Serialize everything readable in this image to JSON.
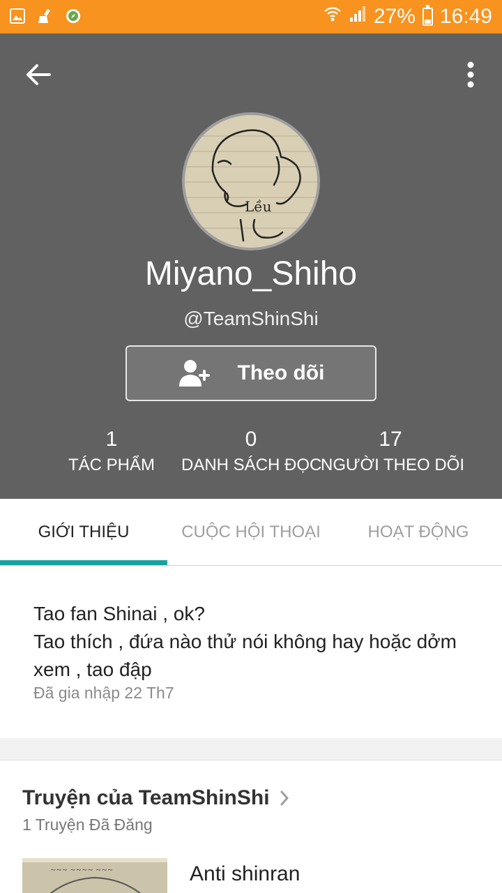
{
  "status_bar": {
    "battery_text": "27%",
    "battery_level": 0.27,
    "time": "16:49",
    "icons": [
      "gallery-icon",
      "cleaner-icon",
      "compass-icon",
      "wifi-icon",
      "signal-icon",
      "battery-icon"
    ]
  },
  "profile": {
    "username": "Miyano_Shiho",
    "handle": "@TeamShinShi",
    "follow_label": "Theo dõi",
    "stats": [
      {
        "value": "1",
        "label": "TÁC PHẨM"
      },
      {
        "value": "0",
        "label": "DANH SÁCH ĐỌC"
      },
      {
        "value": "17",
        "label": "NGƯỜI THEO DÕI"
      }
    ]
  },
  "tabs": [
    {
      "label": "GIỚI THIỆU",
      "active": true
    },
    {
      "label": "CUỘC HỘI THOẠI",
      "active": false
    },
    {
      "label": "HOẠT ĐỘNG",
      "active": false
    }
  ],
  "about": {
    "bio_lines": [
      "Tao fan Shinai , ok?",
      "Tao thích , đứa nào thử nói không hay hoặc dởm xem , tao đập"
    ],
    "joined": "Đã gia nhập 22 Th7"
  },
  "stories": {
    "title": "Truyện của TeamShinShi",
    "count_text": "1 Truyện Đã Đăng",
    "items": [
      {
        "title": "Anti shinran"
      }
    ]
  },
  "colors": {
    "status_bar": "#f7931e",
    "header_bg": "#616161",
    "tab_accent": "#16a3a0"
  }
}
